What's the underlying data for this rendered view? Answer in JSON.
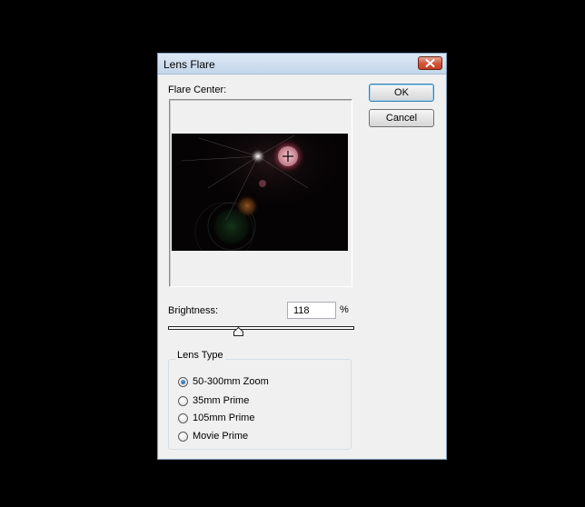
{
  "dialog": {
    "title": "Lens Flare",
    "close_icon": "close-x-icon"
  },
  "flare_center": {
    "label": "Flare Center:",
    "crosshair_icon": "crosshair-icon"
  },
  "buttons": {
    "ok": "OK",
    "cancel": "Cancel"
  },
  "brightness": {
    "label": "Brightness:",
    "value": "118",
    "unit": "%",
    "slider_level": 0.38
  },
  "lens_type": {
    "title": "Lens Type",
    "options": [
      {
        "label": "50-300mm Zoom",
        "checked": true
      },
      {
        "label": "35mm Prime",
        "checked": false
      },
      {
        "label": "105mm Prime",
        "checked": false
      },
      {
        "label": "Movie Prime",
        "checked": false
      }
    ]
  },
  "colors": {
    "flare": "#e0708a",
    "accent": "#3c7fb1"
  }
}
